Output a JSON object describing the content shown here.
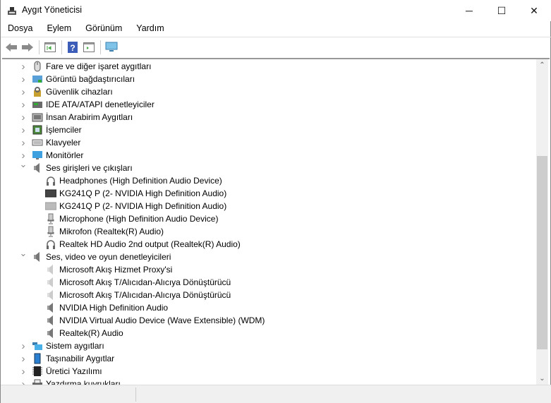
{
  "window": {
    "title": "Aygıt Yöneticisi",
    "minimize": "─",
    "maximize": "☐",
    "close": "✕"
  },
  "menu": [
    "Dosya",
    "Eylem",
    "Görünüm",
    "Yardım"
  ],
  "toolbar": [
    "back-icon",
    "forward-icon",
    "properties-icon",
    "help-icon",
    "update-driver-icon",
    "scan-hardware-icon"
  ],
  "tree": [
    {
      "label": "Fare ve diğer işaret aygıtları",
      "level": 0,
      "expanded": false,
      "icon": "mouse"
    },
    {
      "label": "Görüntü bağdaştırıcıları",
      "level": 0,
      "expanded": false,
      "icon": "display-adapter"
    },
    {
      "label": "Güvenlik cihazları",
      "level": 0,
      "expanded": false,
      "icon": "security"
    },
    {
      "label": "IDE ATA/ATAPI denetleyiciler",
      "level": 0,
      "expanded": false,
      "icon": "ide"
    },
    {
      "label": "İnsan Arabirim Aygıtları",
      "level": 0,
      "expanded": false,
      "icon": "hid"
    },
    {
      "label": "İşlemciler",
      "level": 0,
      "expanded": false,
      "icon": "cpu"
    },
    {
      "label": "Klavyeler",
      "level": 0,
      "expanded": false,
      "icon": "keyboard"
    },
    {
      "label": "Monitörler",
      "level": 0,
      "expanded": false,
      "icon": "monitor"
    },
    {
      "label": "Ses girişleri ve çıkışları",
      "level": 0,
      "expanded": true,
      "icon": "speaker"
    },
    {
      "label": "Headphones (High Definition Audio Device)",
      "level": 1,
      "icon": "headphones"
    },
    {
      "label": "KG241Q P (2- NVIDIA High Definition Audio)",
      "level": 1,
      "icon": "monitor-dark"
    },
    {
      "label": "KG241Q P (2- NVIDIA High Definition Audio)",
      "level": 1,
      "icon": "monitor-light"
    },
    {
      "label": "Microphone (High Definition Audio Device)",
      "level": 1,
      "icon": "microphone"
    },
    {
      "label": "Mikrofon (Realtek(R) Audio)",
      "level": 1,
      "icon": "microphone"
    },
    {
      "label": "Realtek HD Audio 2nd output (Realtek(R) Audio)",
      "level": 1,
      "icon": "headphones"
    },
    {
      "label": "Ses, video ve oyun denetleyicileri",
      "level": 0,
      "expanded": true,
      "icon": "speaker"
    },
    {
      "label": "Microsoft Akış Hizmet Proxy'si",
      "level": 1,
      "icon": "speaker-light"
    },
    {
      "label": "Microsoft Akış T/Alıcıdan-Alıcıya Dönüştürücü",
      "level": 1,
      "icon": "speaker-light"
    },
    {
      "label": "Microsoft Akış T/Alıcıdan-Alıcıya Dönüştürücü",
      "level": 1,
      "icon": "speaker-light"
    },
    {
      "label": "NVIDIA High Definition Audio",
      "level": 1,
      "icon": "speaker"
    },
    {
      "label": "NVIDIA Virtual Audio Device (Wave Extensible) (WDM)",
      "level": 1,
      "icon": "speaker"
    },
    {
      "label": "Realtek(R) Audio",
      "level": 1,
      "icon": "speaker"
    },
    {
      "label": "Sistem aygıtları",
      "level": 0,
      "expanded": false,
      "icon": "system"
    },
    {
      "label": "Taşınabilir Aygıtlar",
      "level": 0,
      "expanded": false,
      "icon": "portable"
    },
    {
      "label": "Üretici Yazılımı",
      "level": 0,
      "expanded": false,
      "icon": "firmware"
    },
    {
      "label": "Yazdırma kuyrukları",
      "level": 0,
      "expanded": false,
      "icon": "printer"
    }
  ],
  "scroll": {
    "thumb_start_fraction": 0.3,
    "thumb_size_fraction": 0.6
  }
}
